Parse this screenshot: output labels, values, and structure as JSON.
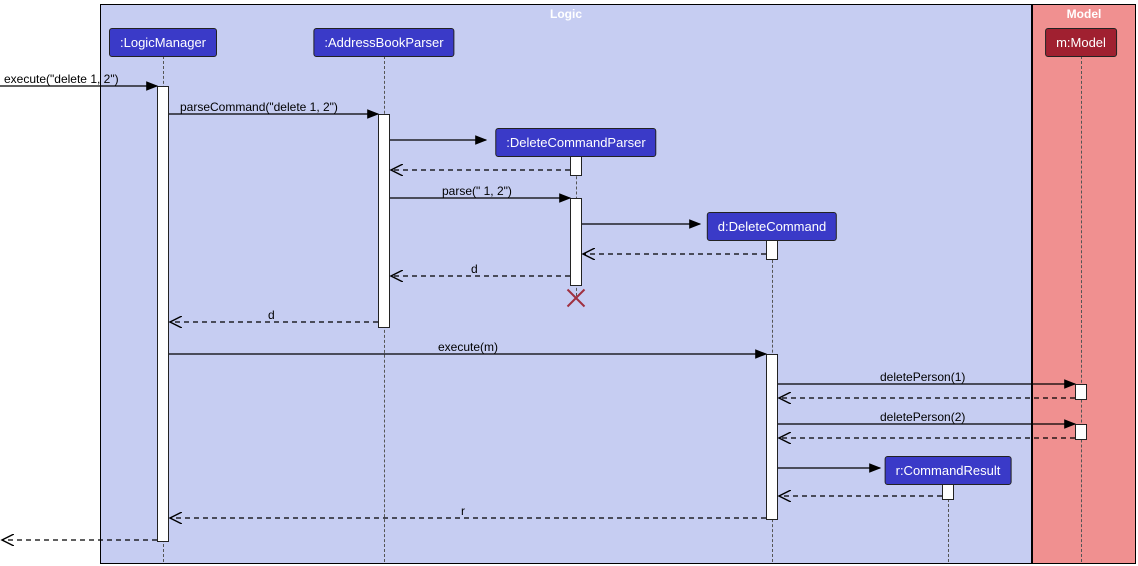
{
  "frames": {
    "logic": "Logic",
    "model": "Model"
  },
  "participants": {
    "logicManager": ":LogicManager",
    "addressBookParser": ":AddressBookParser",
    "deleteCommandParser": ":DeleteCommandParser",
    "deleteCommand": "d:DeleteCommand",
    "commandResult": "r:CommandResult",
    "model": "m:Model"
  },
  "messages": {
    "executeIn": "execute(\"delete 1, 2\")",
    "parseCommand": "parseCommand(\"delete 1, 2\")",
    "parse": "parse(\" 1, 2\")",
    "d1": "d",
    "d2": "d",
    "executeM": "execute(m)",
    "deletePerson1": "deletePerson(1)",
    "deletePerson2": "deletePerson(2)",
    "r": "r"
  }
}
